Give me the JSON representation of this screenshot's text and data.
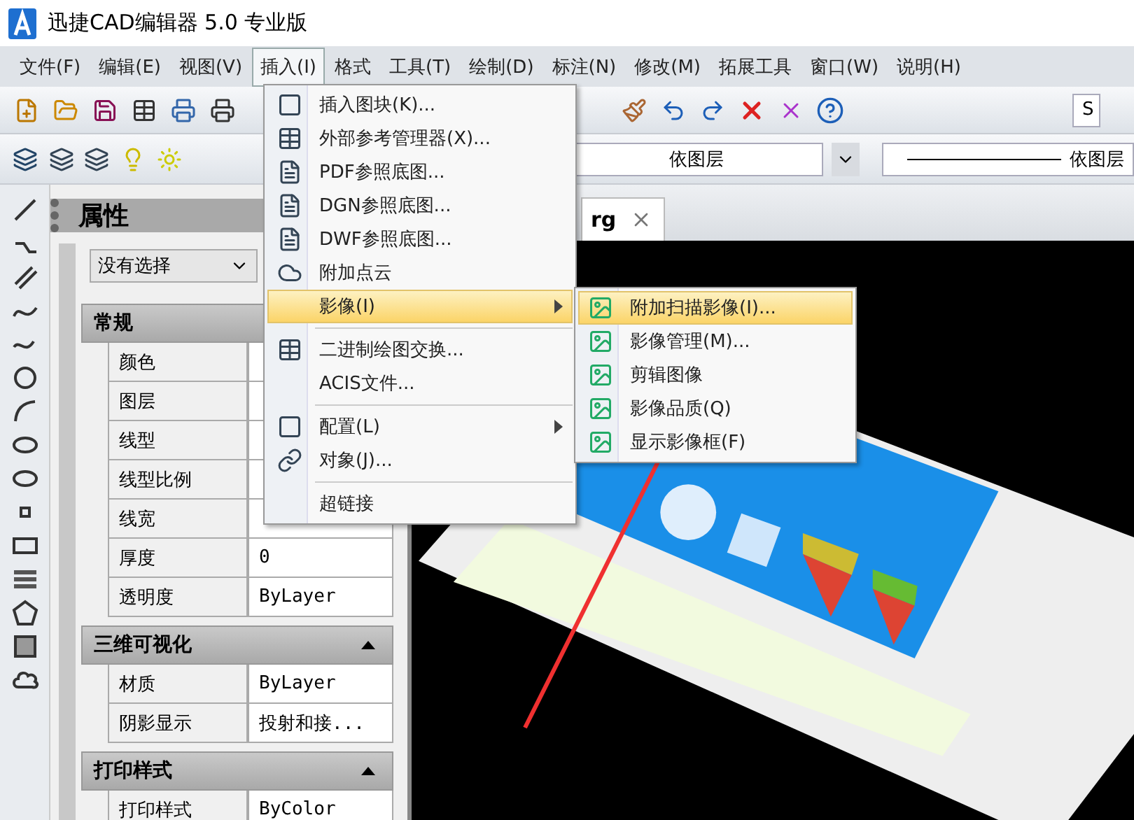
{
  "window": {
    "title": "迅捷CAD编辑器 5.0 专业版"
  },
  "menubar": [
    {
      "label": "文件(F)",
      "selected": false
    },
    {
      "label": "编辑(E)",
      "selected": false
    },
    {
      "label": "视图(V)",
      "selected": false
    },
    {
      "label": "插入(I)",
      "selected": true
    },
    {
      "label": "格式",
      "selected": false
    },
    {
      "label": "工具(T)",
      "selected": false
    },
    {
      "label": "绘制(D)",
      "selected": false
    },
    {
      "label": "标注(N)",
      "selected": false
    },
    {
      "label": "修改(M)",
      "selected": false
    },
    {
      "label": "拓展工具",
      "selected": false
    },
    {
      "label": "窗口(W)",
      "selected": false
    },
    {
      "label": "说明(H)",
      "selected": false
    }
  ],
  "toolbar": {
    "style_field": "S"
  },
  "layer_toolbar": {
    "layer_field": "依图层",
    "linetype_field": "依图层"
  },
  "properties": {
    "title": "属性",
    "selection": "没有选择",
    "sections": [
      {
        "title": "常规",
        "rows": [
          {
            "name": "颜色"
          },
          {
            "name": "图层"
          },
          {
            "name": "线型"
          },
          {
            "name": "线型比例"
          },
          {
            "name": "线宽"
          },
          {
            "name": "厚度",
            "value": "0"
          },
          {
            "name": "透明度",
            "value": "ByLayer"
          }
        ]
      },
      {
        "title": "三维可视化",
        "expanded": true,
        "rows": [
          {
            "name": "材质",
            "value": "ByLayer"
          },
          {
            "name": "阴影显示",
            "value": "投射和接..."
          }
        ]
      },
      {
        "title": "打印样式",
        "expanded": true,
        "rows": [
          {
            "name": "打印样式",
            "value": "ByColor"
          }
        ]
      }
    ]
  },
  "document_tab": {
    "label": "rg"
  },
  "insert_menu": [
    {
      "kind": "item",
      "label": "插入图块(K)...",
      "selected": false
    },
    {
      "kind": "item",
      "label": "外部参考管理器(X)...",
      "selected": false
    },
    {
      "kind": "item",
      "label": "PDF参照底图...",
      "selected": false
    },
    {
      "kind": "item",
      "label": "DGN参照底图...",
      "selected": false
    },
    {
      "kind": "item",
      "label": "DWF参照底图...",
      "selected": false
    },
    {
      "kind": "item",
      "label": "附加点云",
      "selected": false
    },
    {
      "kind": "submenu",
      "label": "影像(I)",
      "selected": true
    },
    {
      "kind": "separator"
    },
    {
      "kind": "item",
      "label": "二进制绘图交换...",
      "selected": false
    },
    {
      "kind": "item",
      "label": "ACIS文件...",
      "selected": false
    },
    {
      "kind": "separator"
    },
    {
      "kind": "submenu",
      "label": "配置(L)",
      "selected": false
    },
    {
      "kind": "item",
      "label": "对象(J)...",
      "selected": false
    },
    {
      "kind": "separator"
    },
    {
      "kind": "item",
      "label": "超链接",
      "selected": false
    }
  ],
  "image_submenu": [
    {
      "label": "附加扫描影像(I)...",
      "selected": true
    },
    {
      "label": "影像管理(M)...",
      "selected": false
    },
    {
      "label": "剪辑图像",
      "selected": false
    },
    {
      "label": "影像品质(Q)",
      "selected": false
    },
    {
      "label": "显示影像框(F)",
      "selected": false
    }
  ]
}
